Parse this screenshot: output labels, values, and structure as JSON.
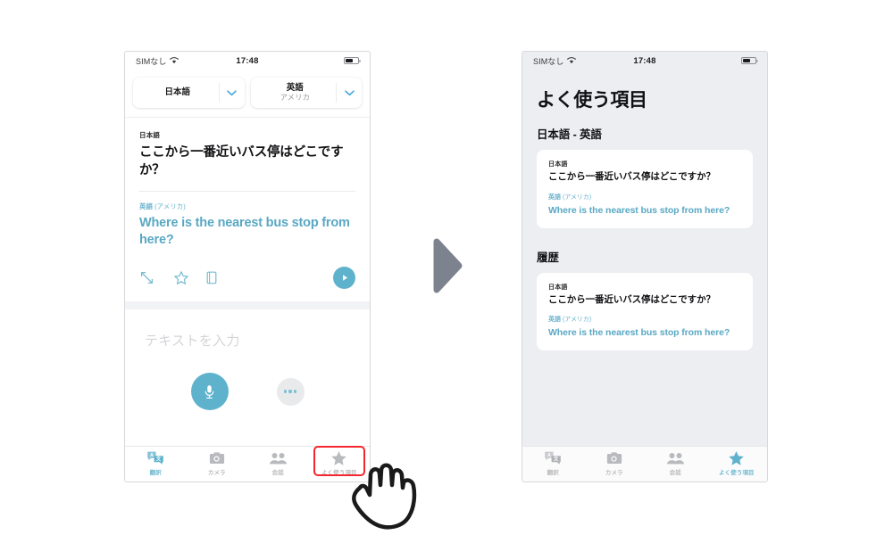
{
  "statusbar": {
    "carrier": "SIMなし",
    "time": "17:48",
    "wifi_icon": "wifi-icon",
    "battery_icon": "battery-icon"
  },
  "screen_left": {
    "name": "translate-screen",
    "language_source": {
      "main": "日本語",
      "sub": ""
    },
    "language_target": {
      "main": "英語",
      "sub": "アメリカ"
    },
    "chevron_icon": "chevron-down-icon",
    "result_card": {
      "source_label": "日本語",
      "source_text": "ここから一番近いバス停はどこですか？",
      "target_label_lang": "英語",
      "target_label_region": "(アメリカ)",
      "target_text": "Where is the nearest bus stop from here?",
      "actions": [
        {
          "name": "expand-icon",
          "label": "全画面表示"
        },
        {
          "name": "star-icon",
          "label": "お気に入り"
        },
        {
          "name": "dictionary-icon",
          "label": "辞書"
        },
        {
          "name": "play-icon",
          "label": "再生"
        }
      ]
    },
    "input": {
      "placeholder": "テキストを入力",
      "value": "",
      "mic_icon": "microphone-icon",
      "more_icon": "more-dots-icon"
    }
  },
  "screen_right": {
    "name": "favorites-screen",
    "title": "よく使う項目",
    "sections": [
      {
        "heading": "日本語 - 英語",
        "card": {
          "source_label": "日本語",
          "source_text": "ここから一番近いバス停はどこですか？",
          "target_label_lang": "英語",
          "target_label_region": "(アメリカ)",
          "target_text": "Where is the nearest bus stop from here?"
        }
      },
      {
        "heading": "履歴",
        "card": {
          "source_label": "日本語",
          "source_text": "ここから一番近いバス停はどこですか？",
          "target_label_lang": "英語",
          "target_label_region": "(アメリカ)",
          "target_text": "Where is the nearest bus stop from here?"
        }
      }
    ]
  },
  "tabbar": {
    "tabs": [
      {
        "id": "translate",
        "label": "翻訳",
        "icon": "translate-icon"
      },
      {
        "id": "camera",
        "label": "カメラ",
        "icon": "camera-icon"
      },
      {
        "id": "conversation",
        "label": "会話",
        "icon": "people-icon"
      },
      {
        "id": "favorites",
        "label": "よく使う項目",
        "icon": "star-icon"
      }
    ],
    "active_left": "translate",
    "active_right": "favorites"
  },
  "annotations": {
    "highlight_target": "favorites",
    "highlight_color": "#f4262b",
    "cursor_icon": "pointing-hand-cursor",
    "flow_arrow_icon": "play-triangle-arrow-icon"
  },
  "colors": {
    "accent": "#5fb2cc",
    "highlight": "#f4262b",
    "screen_bg": "#eceef1",
    "inactive_tab": "#b9babd"
  }
}
